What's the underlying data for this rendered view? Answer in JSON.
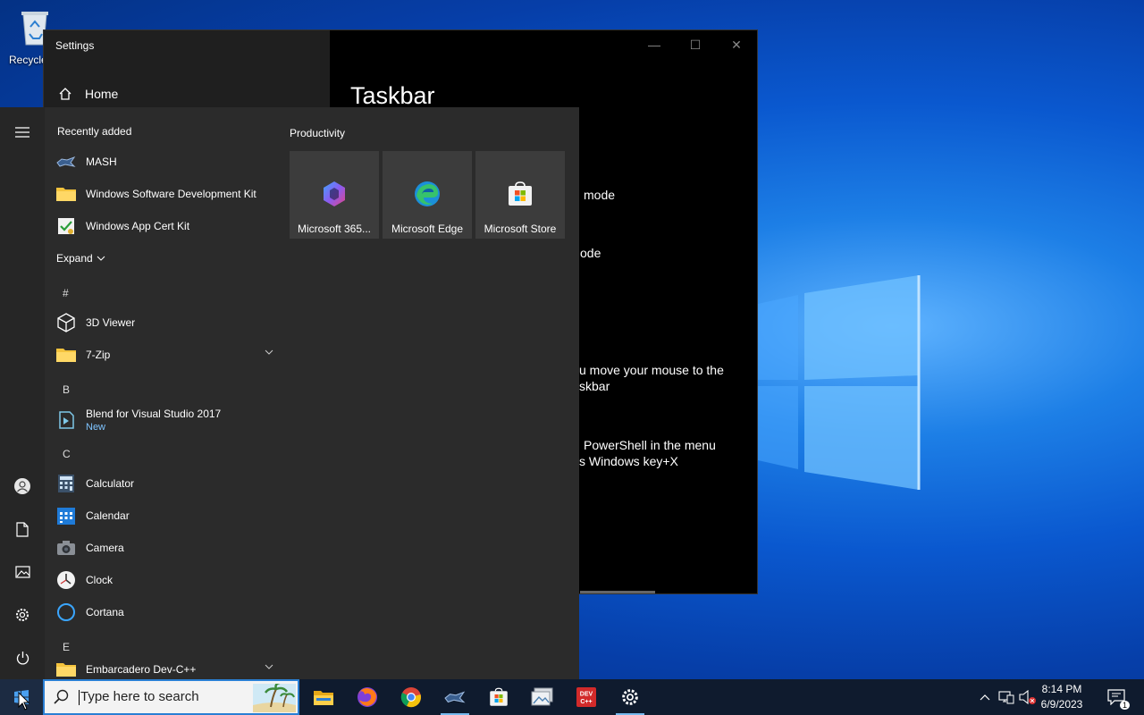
{
  "desktop": {
    "recycle_bin_label": "Recycle"
  },
  "settings": {
    "window_title": "Settings",
    "home_label": "Home",
    "page_title": "Taskbar",
    "visible_fragments": [
      "mode",
      "ode",
      "u move your mouse to the",
      "skbar",
      "PowerShell in the menu",
      "s Windows key+X"
    ]
  },
  "start_menu": {
    "recently_added_title": "Recently added",
    "recently_added": [
      {
        "label": "MASH",
        "icon": "mash-icon"
      },
      {
        "label": "Windows Software Development Kit",
        "icon": "folder-icon"
      },
      {
        "label": "Windows App Cert Kit",
        "icon": "cert-kit-icon"
      }
    ],
    "expand_label": "Expand",
    "groups": [
      {
        "letter": "#",
        "apps": [
          {
            "label": "3D Viewer",
            "icon": "cube-icon"
          },
          {
            "label": "7-Zip",
            "icon": "folder-icon",
            "expandable": true
          }
        ]
      },
      {
        "letter": "B",
        "apps": [
          {
            "label": "Blend for Visual Studio 2017",
            "sub": "New",
            "icon": "blend-icon"
          }
        ]
      },
      {
        "letter": "C",
        "apps": [
          {
            "label": "Calculator",
            "icon": "calculator-icon"
          },
          {
            "label": "Calendar",
            "icon": "calendar-icon"
          },
          {
            "label": "Camera",
            "icon": "camera-icon"
          },
          {
            "label": "Clock",
            "icon": "clock-icon"
          },
          {
            "label": "Cortana",
            "icon": "cortana-icon"
          }
        ]
      },
      {
        "letter": "E",
        "apps": [
          {
            "label": "Embarcadero Dev-C++",
            "icon": "folder-icon",
            "expandable": true
          }
        ]
      }
    ],
    "tiles_group_title": "Productivity",
    "tiles": [
      {
        "label": "Microsoft 365...",
        "icon": "microsoft-365-icon"
      },
      {
        "label": "Microsoft Edge",
        "icon": "edge-icon"
      },
      {
        "label": "Microsoft Store",
        "icon": "store-icon"
      }
    ],
    "rail_icons": [
      "hamburger-menu-icon",
      "user-icon",
      "documents-icon",
      "pictures-icon",
      "settings-gear-icon",
      "power-icon"
    ]
  },
  "taskbar": {
    "search_placeholder": "Type here to search",
    "pinned": [
      "file-explorer-icon",
      "firefox-icon",
      "chrome-icon",
      "mash-icon",
      "store-icon",
      "image-viewer-icon",
      "devcpp-icon",
      "settings-gear-icon"
    ],
    "active_app": "settings-gear-icon",
    "time": "8:14 PM",
    "date": "6/9/2023",
    "notification_count": "1",
    "devcpp_text": "DEV C++"
  },
  "colors": {
    "accent": "#0078d7",
    "start_bg": "#2b2b2b",
    "tile_bg": "#3c3c3c",
    "taskbar_bg": "#0f1b2e",
    "new_badge": "#7fc4ff"
  }
}
